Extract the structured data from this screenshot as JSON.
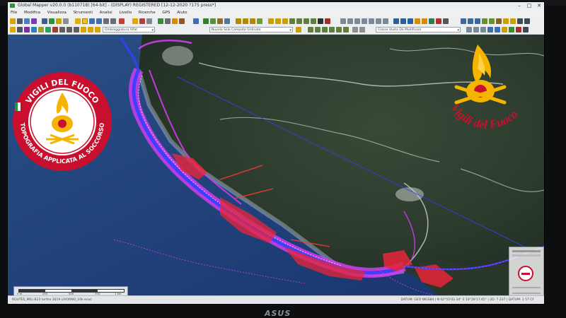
{
  "window": {
    "title": "Global Mapper v20.0.0 (b110718) [64-bit] - (DISPLAY) REGISTERED [12-12-2020 ?175 press*]",
    "minimize": "–",
    "maximize": "□",
    "close": "✕"
  },
  "menu": [
    "File",
    "Modifica",
    "Visualizza",
    "Strumenti",
    "Analisi",
    "Livello",
    "Ricerche",
    "GPS",
    "Aiuto"
  ],
  "toolbar": {
    "combo_projection": "Ombreggiatura Alfat",
    "combo_layer": "Nuvola Sola Campata Ordinata",
    "combo_feature": "Classe Vuota Da Modificare"
  },
  "logos": {
    "left_text_top": "VIGILI DEL FUOCO",
    "left_text_bottom": "TOPOGRAFIA APPLICATA AL SOCCORSO",
    "right_text": "Vigili del Fuoco"
  },
  "map": {
    "scale_labels": [
      "0 m",
      "250",
      "500",
      "750",
      "1 km"
    ]
  },
  "status": {
    "left": "ROUTES_MEL:B23 (ortho 2019 LIVORNO_10k.ecw)",
    "right": "DATUM: GEO WGS84 | N 42°55'02.34\" E 10°28'17.65\" | 2D: 7 237 | DATUM: 1 57 CF"
  },
  "monitor": {
    "brand": "ASUS"
  },
  "colors": {
    "route_magenta": "#d23cf0",
    "route_blue": "#3040ff",
    "hazard_red": "#e8253a",
    "logo_red": "#c8102e",
    "logo_gold": "#f4b400"
  }
}
